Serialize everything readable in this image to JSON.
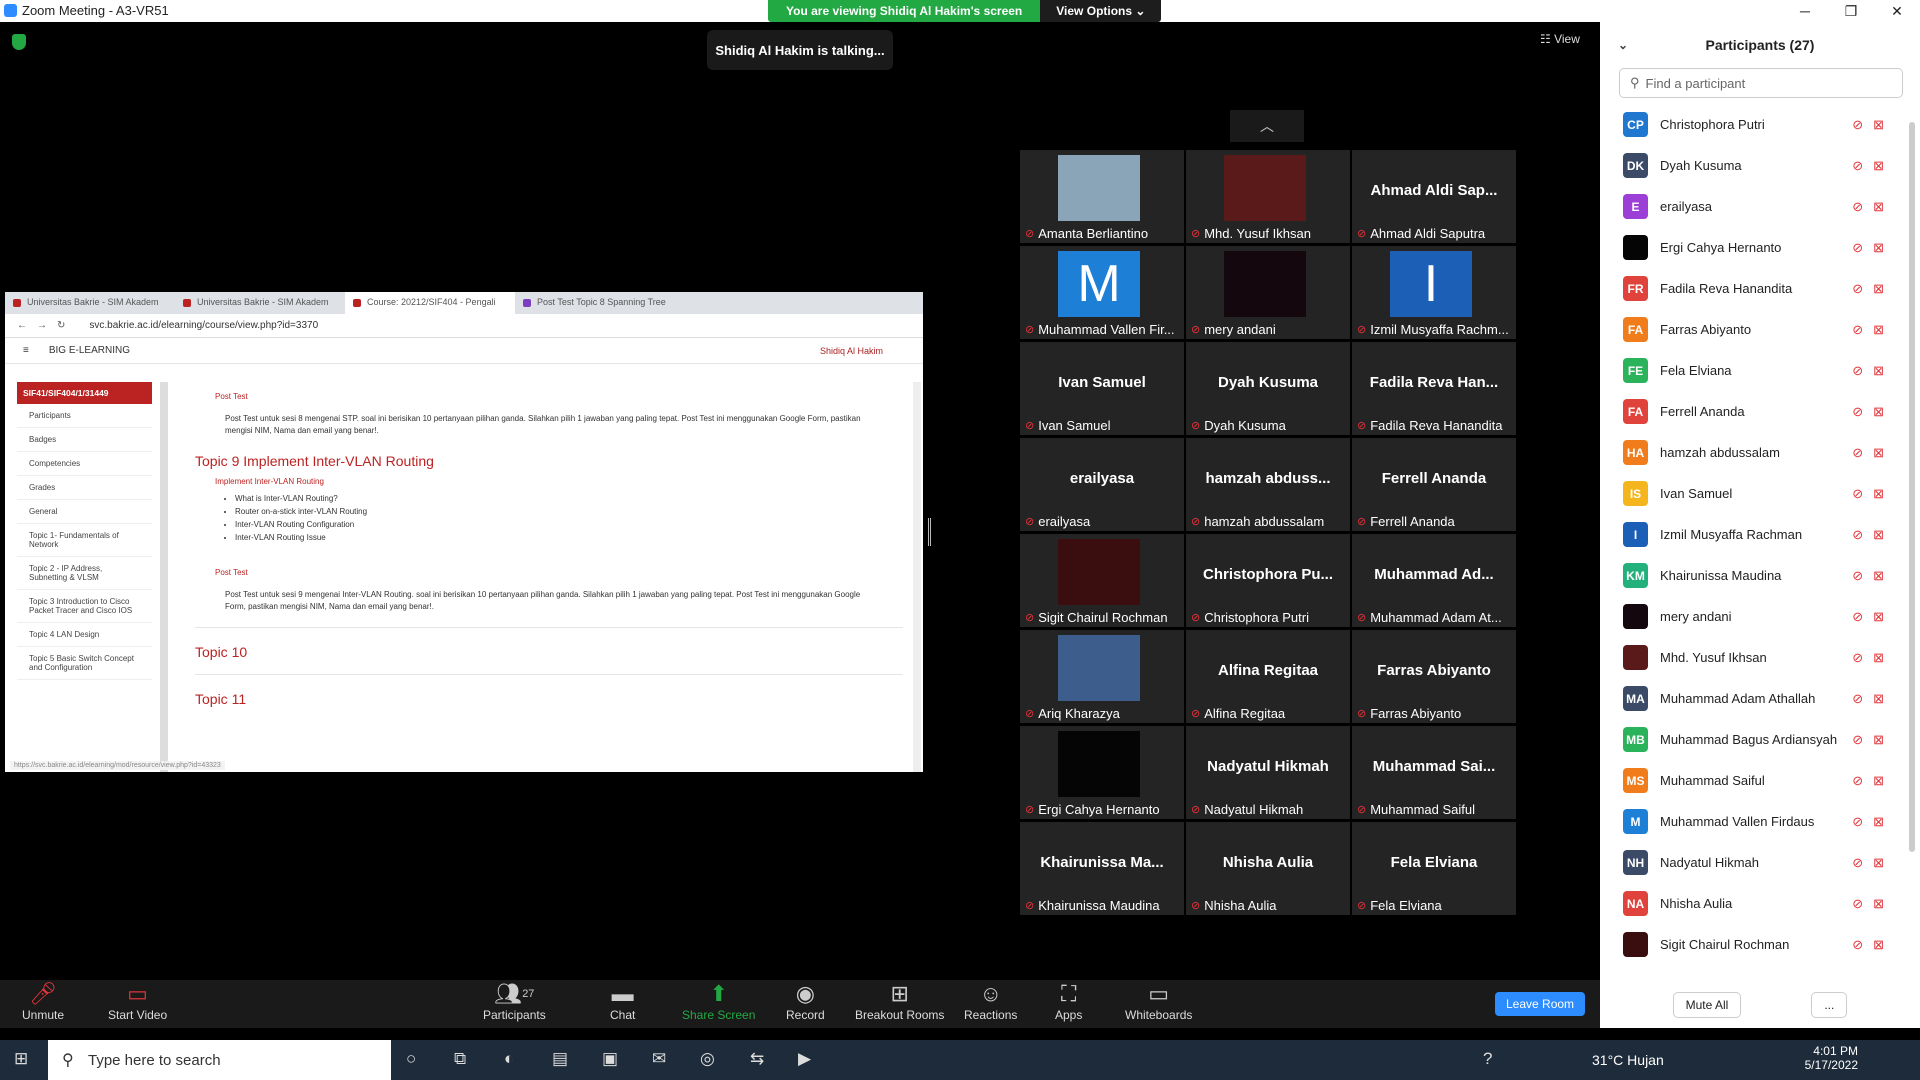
{
  "window": {
    "title": "Zoom Meeting - A3-VR51",
    "minimize": "─",
    "maximize": "❐",
    "close": "✕"
  },
  "banner": {
    "viewing": "You are viewing Shidiq Al Hakim's screen",
    "view_options": "View Options ⌄"
  },
  "talking": "Shidiq Al Hakim is talking...",
  "view_button": "☷ View",
  "shared": {
    "tabs": [
      "Universitas Bakrie - SIM Akadem",
      "Universitas Bakrie - SIM Akadem",
      "Course: 20212/SIF404 - Pengali",
      "Post Test Topic 8 Spanning Tree"
    ],
    "url": "svc.bakrie.ac.id/elearning/course/view.php?id=3370",
    "site": "BIG E-LEARNING",
    "user": "Shidiq Al Hakim",
    "course_code": "SIF41/SIF404/1/31449",
    "sidebar": [
      "Participants",
      "Badges",
      "Competencies",
      "Grades",
      "General",
      "Topic 1- Fundamentals of Network",
      "Topic 2 - IP Address, Subnetting & VLSM",
      "Topic 3 Introduction to Cisco Packet Tracer and Cisco IOS",
      "Topic 4 LAN Design",
      "Topic 5 Basic Switch Concept and Configuration"
    ],
    "post_test_1": "Post Test",
    "post_test_1_desc": "Post Test untuk sesi 8 mengenai STP. soal ini berisikan 10 pertanyaan pilihan ganda. Silahkan pilih 1 jawaban yang paling tepat. Post Test ini menggunakan Google Form, pastikan mengisi NIM, Nama dan email yang benar!.",
    "topic9": "Topic 9 Implement Inter-VLAN Routing",
    "topic9_link": "Implement Inter-VLAN Routing",
    "topic9_items": [
      "What is Inter-VLAN Routing?",
      "Router on-a-stick inter-VLAN Routing",
      "Inter-VLAN Routing Configuration",
      "Inter-VLAN Routing Issue"
    ],
    "post_test_2": "Post Test",
    "post_test_2_desc": "Post Test untuk sesi 9 mengenai Inter-VLAN Routing. soal ini berisikan 10 pertanyaan pilihan ganda. Silahkan pilih 1 jawaban yang paling tepat. Post Test ini menggunakan Google Form, pastikan mengisi NIM, Nama dan email yang benar!.",
    "topic10": "Topic 10",
    "topic11": "Topic 11",
    "status_url": "https://svc.bakrie.ac.id/elearning/mod/resource/view.php?id=43323"
  },
  "gallery": [
    {
      "big": "",
      "name": "Amanta Berliantino",
      "pic": "photo-cat",
      "color": "#8aa5b8"
    },
    {
      "big": "",
      "name": "Mhd. Yusuf Ikhsan",
      "pic": "photo-red",
      "color": "#5a1a1a"
    },
    {
      "big": "Ahmad Aldi Sap...",
      "name": "Ahmad Aldi Saputra",
      "pic": "",
      "color": ""
    },
    {
      "big": "",
      "name": "Muhammad Vallen Fir...",
      "pic": "letter",
      "letter": "M",
      "color": "#1e7fd6"
    },
    {
      "big": "",
      "name": "mery andani",
      "pic": "photo-dark",
      "color": "#14070d"
    },
    {
      "big": "",
      "name": "Izmil Musyaffa Rachm...",
      "pic": "letter",
      "letter": "I",
      "color": "#1c5fb6"
    },
    {
      "big": "Ivan Samuel",
      "name": "Ivan Samuel",
      "pic": "",
      "color": ""
    },
    {
      "big": "Dyah Kusuma",
      "name": "Dyah Kusuma",
      "pic": "",
      "color": ""
    },
    {
      "big": "Fadila Reva Han...",
      "name": "Fadila Reva Hanandita",
      "pic": "",
      "color": ""
    },
    {
      "big": "erailyasa",
      "name": "erailyasa",
      "pic": "",
      "color": ""
    },
    {
      "big": "hamzah abduss...",
      "name": "hamzah abdussalam",
      "pic": "",
      "color": ""
    },
    {
      "big": "Ferrell Ananda",
      "name": "Ferrell Ananda",
      "pic": "",
      "color": ""
    },
    {
      "big": "",
      "name": "Sigit Chairul Rochman",
      "pic": "photo-red2",
      "color": "#3a0e0e"
    },
    {
      "big": "Christophora Pu...",
      "name": "Christophora Putri",
      "pic": "",
      "color": ""
    },
    {
      "big": "Muhammad Ad...",
      "name": "Muhammad Adam At...",
      "pic": "",
      "color": ""
    },
    {
      "big": "",
      "name": "Ariq Kharazya",
      "pic": "photo-sky",
      "color": "#3d5d8c"
    },
    {
      "big": "Alfina Regitaa",
      "name": "Alfina Regitaa",
      "pic": "",
      "color": ""
    },
    {
      "big": "Farras Abiyanto",
      "name": "Farras Abiyanto",
      "pic": "",
      "color": ""
    },
    {
      "big": "",
      "name": "Ergi Cahya Hernanto",
      "pic": "photo-black",
      "color": "#050505"
    },
    {
      "big": "Nadyatul Hikmah",
      "name": "Nadyatul Hikmah",
      "pic": "",
      "color": ""
    },
    {
      "big": "Muhammad Sai...",
      "name": "Muhammad Saiful",
      "pic": "",
      "color": ""
    },
    {
      "big": "Khairunissa Ma...",
      "name": "Khairunissa Maudina",
      "pic": "",
      "color": ""
    },
    {
      "big": "Nhisha Aulia",
      "name": "Nhisha Aulia",
      "pic": "",
      "color": ""
    },
    {
      "big": "Fela Elviana",
      "name": "Fela Elviana",
      "pic": "",
      "color": ""
    }
  ],
  "participants": {
    "title": "Participants (27)",
    "search_placeholder": "Find a participant",
    "list": [
      {
        "initials": "CP",
        "name": "Christophora Putri",
        "color": "#1f77d0"
      },
      {
        "initials": "DK",
        "name": "Dyah Kusuma",
        "color": "#3b4a66"
      },
      {
        "initials": "E",
        "name": "erailyasa",
        "color": "#9b3fd6"
      },
      {
        "initials": "",
        "name": "Ergi Cahya Hernanto",
        "color": "#050505"
      },
      {
        "initials": "FR",
        "name": "Fadila Reva Hanandita",
        "color": "#e0433b"
      },
      {
        "initials": "FA",
        "name": "Farras Abiyanto",
        "color": "#f07c1b"
      },
      {
        "initials": "FE",
        "name": "Fela Elviana",
        "color": "#2bb35b"
      },
      {
        "initials": "FA",
        "name": "Ferrell Ananda",
        "color": "#e0433b"
      },
      {
        "initials": "HA",
        "name": "hamzah abdussalam",
        "color": "#f07c1b"
      },
      {
        "initials": "IS",
        "name": "Ivan Samuel",
        "color": "#f5b51c"
      },
      {
        "initials": "I",
        "name": "Izmil Musyaffa Rachman",
        "color": "#1c5fb6"
      },
      {
        "initials": "KM",
        "name": "Khairunissa Maudina",
        "color": "#22b07d"
      },
      {
        "initials": "",
        "name": "mery andani",
        "color": "#14070d"
      },
      {
        "initials": "",
        "name": "Mhd. Yusuf Ikhsan",
        "color": "#5a1a1a"
      },
      {
        "initials": "MA",
        "name": "Muhammad Adam Athallah",
        "color": "#3b4a66"
      },
      {
        "initials": "MB",
        "name": "Muhammad Bagus Ardiansyah",
        "color": "#2bb35b"
      },
      {
        "initials": "MS",
        "name": "Muhammad Saiful",
        "color": "#f07c1b"
      },
      {
        "initials": "M",
        "name": "Muhammad Vallen Firdaus",
        "color": "#1e7fd6"
      },
      {
        "initials": "NH",
        "name": "Nadyatul Hikmah",
        "color": "#3b4a66"
      },
      {
        "initials": "NA",
        "name": "Nhisha Aulia",
        "color": "#e0433b"
      },
      {
        "initials": "",
        "name": "Sigit Chairul Rochman",
        "color": "#3a0e0e"
      }
    ],
    "mute_all": "Mute All",
    "more": "..."
  },
  "toolbar": {
    "unmute": "Unmute",
    "start_video": "Start Video",
    "participants": "Participants",
    "participants_count": "27",
    "chat": "Chat",
    "share_screen": "Share Screen",
    "record": "Record",
    "breakout_rooms": "Breakout Rooms",
    "reactions": "Reactions",
    "apps": "Apps",
    "whiteboards": "Whiteboards",
    "leave": "Leave Room"
  },
  "taskbar": {
    "search_placeholder": "Type here to search",
    "weather": "31°C  Hujan",
    "time": "4:01 PM",
    "date": "5/17/2022"
  },
  "colors": {
    "zoom_blue": "#2d8cff",
    "green": "#23a943",
    "mute_red": "#e0353b"
  }
}
